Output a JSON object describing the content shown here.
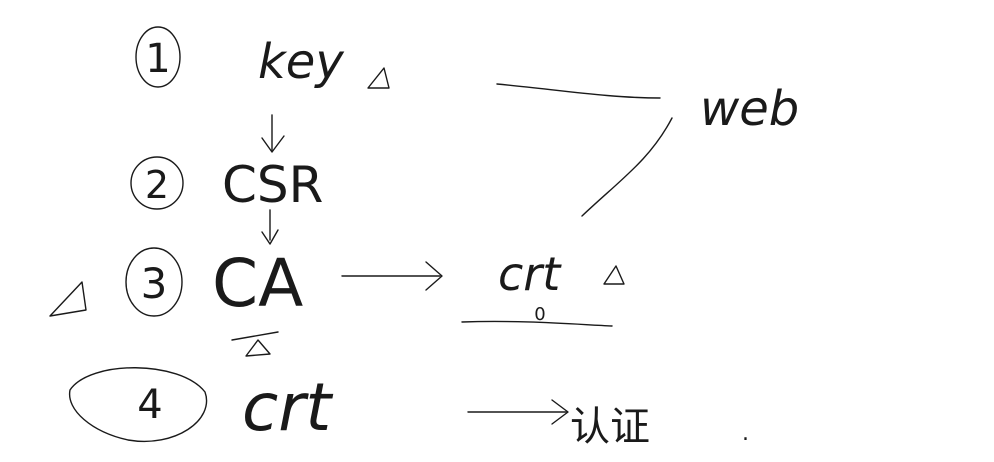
{
  "steps": [
    {
      "number": "1",
      "label": "key"
    },
    {
      "number": "2",
      "label": "CSR"
    },
    {
      "number": "3",
      "label": "CA"
    },
    {
      "number": "4",
      "label": "crt"
    }
  ],
  "web_label": "web",
  "crt_output_label": "crt",
  "crt_underline_mark": "0",
  "verify_label": "认证",
  "trailing_dot": "."
}
